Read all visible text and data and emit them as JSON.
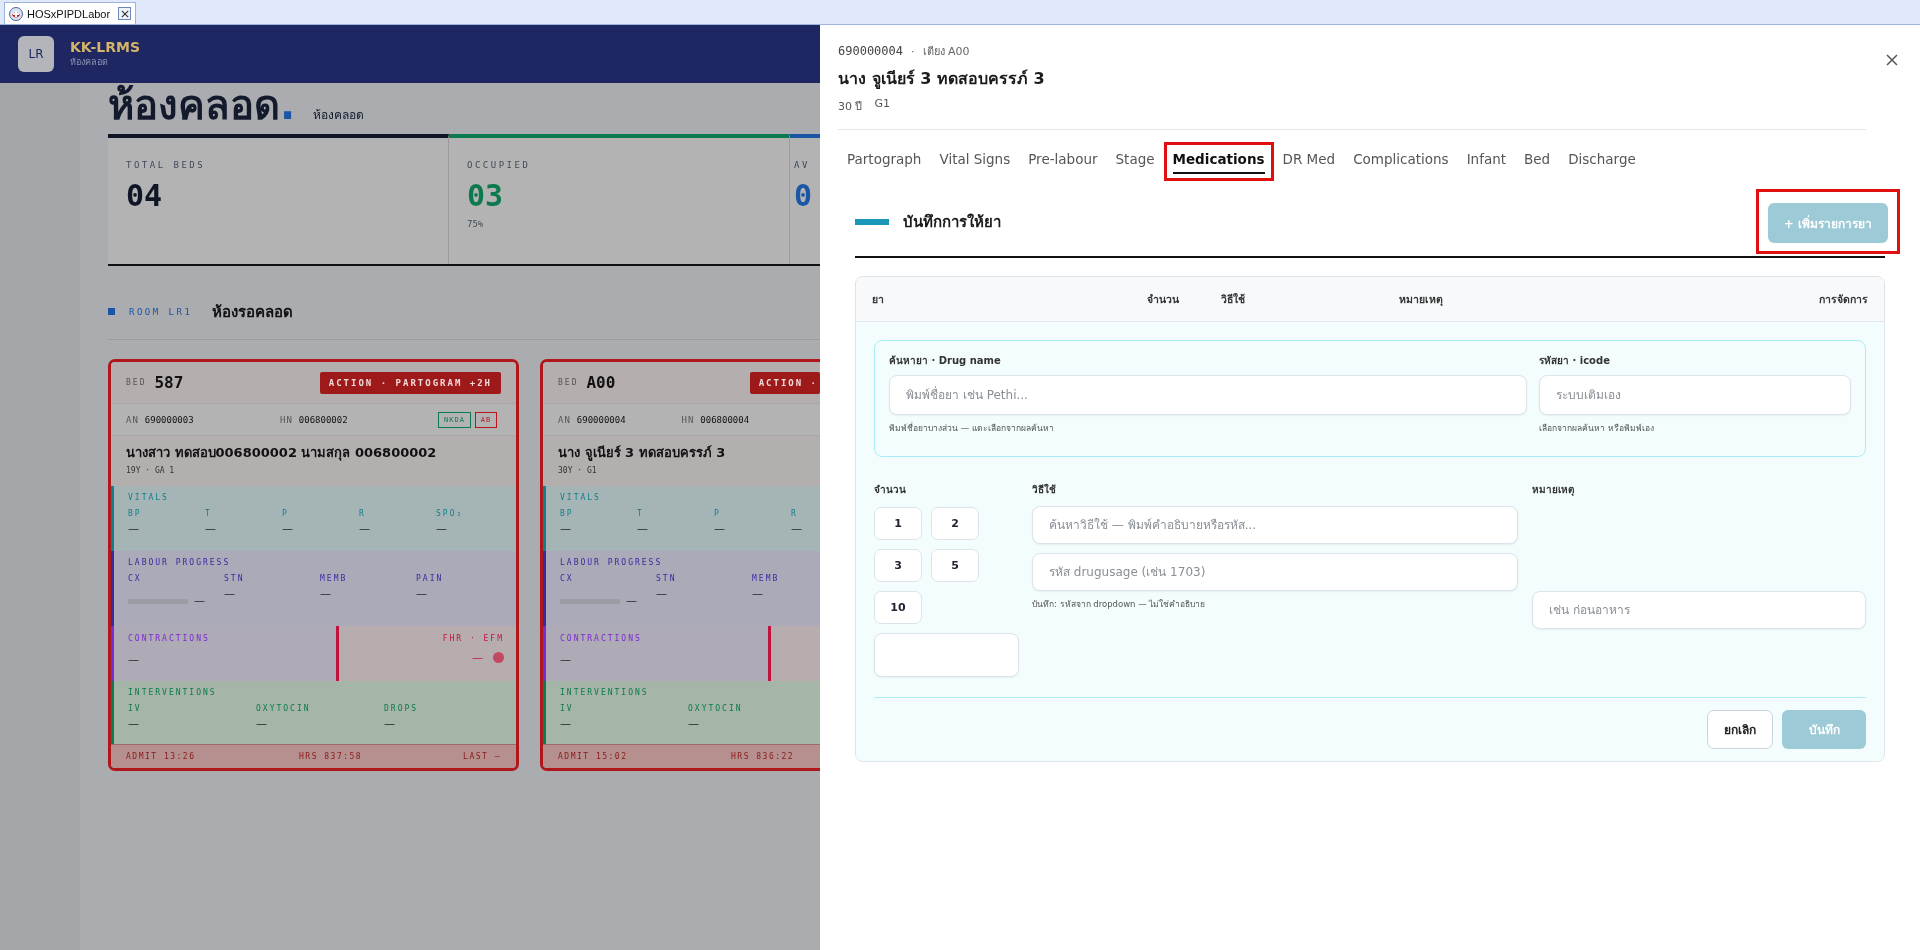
{
  "window_tab": {
    "title": "HOSxPIPDLabor"
  },
  "app_header": {
    "badge": "LR",
    "name": "KK-LRMS",
    "subtitle": "ห้องคลอด"
  },
  "page_heading": {
    "title": "ห้องคลอด",
    "title_mark": ".",
    "subtitle": "ห้องคลอด"
  },
  "stats": [
    {
      "label": "TOTAL BEDS",
      "value": "04",
      "color": "#0f1525"
    },
    {
      "label": "OCCUPIED",
      "value": "03",
      "note": "75%",
      "color": "#0b7a4f"
    },
    {
      "label": "AV",
      "value": "0",
      "color": "#1a56a6"
    }
  ],
  "room": {
    "code": "ROOM LR1",
    "name": "ห้องรอคลอด"
  },
  "beds": [
    {
      "bed_label": "BED",
      "bed": "587",
      "action": "ACTION · PARTOGRAM +2H",
      "an_label": "AN",
      "an": "690000003",
      "hn_label": "HN",
      "hn": "006800002",
      "tags": [
        {
          "text": "NKDA",
          "color": "#0b7a4f"
        },
        {
          "text": "AB",
          "color": "#c0141c"
        }
      ],
      "name": "นางสาว ทดสอบ006800002 นามสกุล 006800002",
      "meta": "19Y · GA 1",
      "vitals": {
        "title": "VITALS",
        "fields": [
          {
            "label": "BP",
            "value": "—"
          },
          {
            "label": "T",
            "value": "—"
          },
          {
            "label": "P",
            "value": "—"
          },
          {
            "label": "R",
            "value": "—"
          },
          {
            "label": "SPO₂",
            "value": "—"
          }
        ]
      },
      "labour": {
        "title": "LABOUR PROGRESS",
        "fields": [
          {
            "label": "CX",
            "value": "—",
            "kind": "bar",
            "level": 0
          },
          {
            "label": "STN",
            "value": "—",
            "kind": "text"
          },
          {
            "label": "MEMB",
            "value": "—",
            "kind": "text"
          },
          {
            "label": "PAIN",
            "value": "—",
            "kind": "text"
          }
        ]
      },
      "contractions": {
        "title": "CONTRACTIONS",
        "value": "—"
      },
      "fhr": {
        "title": "FHR · EFM",
        "value": "—"
      },
      "interventions": {
        "title": "INTERVENTIONS",
        "fields": [
          {
            "label": "IV",
            "value": "—"
          },
          {
            "label": "OXYTOCIN",
            "value": "—"
          },
          {
            "label": "DROPS",
            "value": "—"
          }
        ]
      },
      "footer": {
        "admit": "ADMIT 13:26",
        "hrs": "HRS 837:58",
        "last": "LAST —"
      }
    },
    {
      "bed_label": "BED",
      "bed": "A00",
      "action": "ACTION ·",
      "an_label": "AN",
      "an": "690000004",
      "hn_label": "HN",
      "hn": "006800004",
      "name": "นาง จูเนียร์ 3 ทดสอบครรภ์ 3",
      "meta": "30Y · G1",
      "vitals": {
        "title": "VITALS",
        "fields": [
          {
            "label": "BP",
            "value": "—"
          },
          {
            "label": "T",
            "value": "—"
          },
          {
            "label": "P",
            "value": "—"
          },
          {
            "label": "R",
            "value": "—"
          }
        ]
      },
      "labour": {
        "title": "LABOUR PROGRESS",
        "fields": [
          {
            "label": "CX",
            "value": "—",
            "kind": "bar",
            "level": 0
          },
          {
            "label": "STN",
            "value": "—",
            "kind": "text"
          },
          {
            "label": "MEMB",
            "value": "—",
            "kind": "text"
          }
        ]
      },
      "contractions": {
        "title": "CONTRACTIONS",
        "value": "—"
      },
      "interventions": {
        "title": "INTERVENTIONS",
        "fields": [
          {
            "label": "IV",
            "value": "—"
          },
          {
            "label": "OXYTOCIN",
            "value": "—"
          }
        ]
      },
      "footer": {
        "admit": "ADMIT 15:02",
        "hrs": "HRS 836:22"
      }
    }
  ],
  "drawer": {
    "admission": "690000004",
    "separator": "·",
    "bed": "เตียง A00",
    "patient_name": "นาง จูเนียร์ 3 ทดสอบครรภ์ 3",
    "age": "30 ปี",
    "gravida": "G1",
    "tabs": [
      {
        "label": "Partograph",
        "selected": false,
        "highlighted": false
      },
      {
        "label": "Vital Signs",
        "selected": false,
        "highlighted": false
      },
      {
        "label": "Pre-labour",
        "selected": false,
        "highlighted": false
      },
      {
        "label": "Stage",
        "selected": false,
        "highlighted": false
      },
      {
        "label": "Medications",
        "selected": true,
        "highlighted": true
      },
      {
        "label": "DR Med",
        "selected": false,
        "highlighted": false
      },
      {
        "label": "Complications",
        "selected": false,
        "highlighted": false
      },
      {
        "label": "Infant",
        "selected": false,
        "highlighted": false
      },
      {
        "label": "Bed",
        "selected": false,
        "highlighted": false
      },
      {
        "label": "Discharge",
        "selected": false,
        "highlighted": false
      }
    ],
    "section_title": "บันทึกการให้ยา",
    "add_button": {
      "label": "+ เพิ่มรายการยา",
      "disabled": true,
      "highlighted": true
    },
    "table_columns": [
      "ยา",
      "จำนวน",
      "วิธีใช้",
      "หมายเหตุ",
      "การจัดการ"
    ],
    "form": {
      "drug_name": {
        "label": "ค้นหายา · Drug name",
        "placeholder": "พิมพ์ชื่อยา เช่น Pethi...",
        "hint": "พิมพ์ชื่อยาบางส่วน — แตะเลือกจากผลค้นหา"
      },
      "icode": {
        "label": "รหัสยา · icode",
        "placeholder": "ระบบเติมเอง",
        "hint": "เลือกจากผลค้นหา หรือพิมพ์เอง"
      },
      "quantity": {
        "label": "จำนวน",
        "presets": [
          "1",
          "2",
          "3",
          "5",
          "10"
        ]
      },
      "usage": {
        "label": "วิธีใช้",
        "search_placeholder": "ค้นหาวิธีใช้ — พิมพ์คำอธิบายหรือรหัส...",
        "code_placeholder": "รหัส drugusage (เช่น 1703)",
        "hint": "บันทึก: รหัสจาก dropdown — ไม่ใช่คำอธิบาย"
      },
      "note": {
        "label": "หมายเหตุ",
        "placeholder": "เช่น ก่อนอาหาร"
      },
      "cancel_button": {
        "label": "ยกเลิก"
      },
      "save_button": {
        "label": "บันทึก",
        "disabled": true
      }
    }
  }
}
